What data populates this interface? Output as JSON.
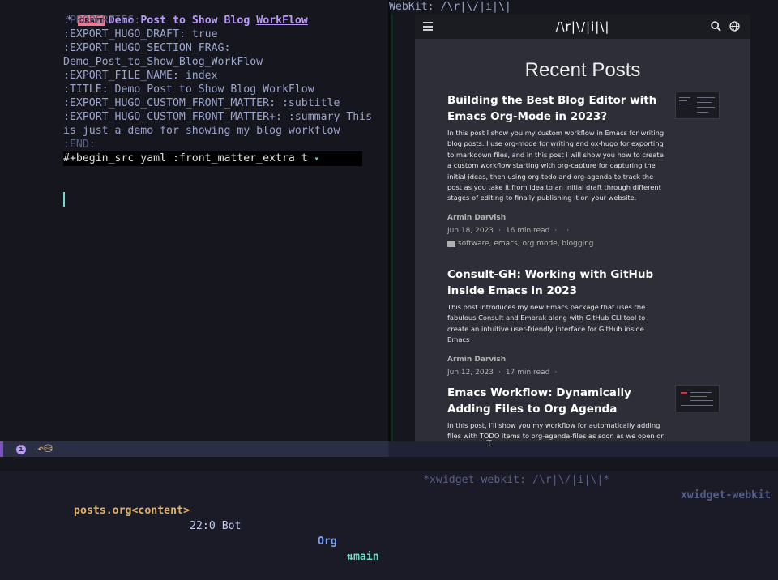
{
  "editor": {
    "heading_star": "*",
    "draft_badge": "DRAFT",
    "heading_title_a": "Demo Post to Show Blog ",
    "heading_title_b": "WorkFlow",
    "lines": {
      "l1": ":PROPERTIES:",
      "l2": ":EXPORT_HUGO_DRAFT: true",
      "l3": ":EXPORT_HUGO_SECTION_FRAG:",
      "l4": "Demo_Post_to_Show_Blog_WorkFlow",
      "l5": ":EXPORT_FILE_NAME: index",
      "l6": ":TITLE: Demo Post to Show Blog WorkFlow",
      "l7": ":EXPORT_HUGO_CUSTOM_FRONT_MATTER: :subtitle",
      "l8": ":EXPORT_HUGO_CUSTOM_FRONT_MATTER+: :summary This",
      "l9": "is just a demo for showing my blog workflow",
      "l10": ":END:",
      "src": "#+begin_src yaml :front_matter_extra t"
    },
    "fold_arrow": "▾"
  },
  "webkit_header": "WebKit: /\\r|\\/|i|\\|",
  "site": {
    "brand": "/\\r|\\/|i|\\|",
    "page_title": "Recent Posts",
    "posts": [
      {
        "title": "Building the Best Blog Editor with Emacs Org-Mode in 2023?",
        "summary": "In this post I show you my custom workflow in Emacs for writing blog posts. I use org-mode for writing and ox-hugo for exporting to markdown files, and in this post i will show you how to create a custom workflow starting with org-capture for capturing the initial ideas, then using org-todo and org-agenda to track the post as you take it from idea to an initial draft through different stages of editing to finally publishing it on your website.",
        "author": "Armin Darvish",
        "date": "Jun 18, 2023",
        "read_time": "16 min read",
        "sep": "·",
        "tags": "software, emacs, org mode, blogging"
      },
      {
        "title": "Consult-GH: Working with GitHub inside Emacs in 2023",
        "summary": "This post introduces my new Emacs package that uses the fabulous Consult and Embrak along with GitHub CLI tool to create an intuitive user-friendly interface for GitHub inside Emacs",
        "author": "Armin Darvish",
        "date": "Jun 12, 2023",
        "read_time": "17 min read",
        "sep": "·"
      },
      {
        "title": "Emacs Workflow: Dynamically Adding Files to Org Agenda",
        "summary": "In this post, I'll show you my workflow for automatically adding files with TODO items to org-agenda-files as soon as we open or save the"
      }
    ]
  },
  "modeline": {
    "info": "i",
    "file": "posts.org<content>",
    "position": "22:0 Bot",
    "major_mode": "Org",
    "branch_icon": "⇅",
    "branch": "main",
    "right_buffer": "*xwidget-webkit: /\\r|\\/|i|\\|*",
    "right_mode": "xwidget-webkit"
  }
}
